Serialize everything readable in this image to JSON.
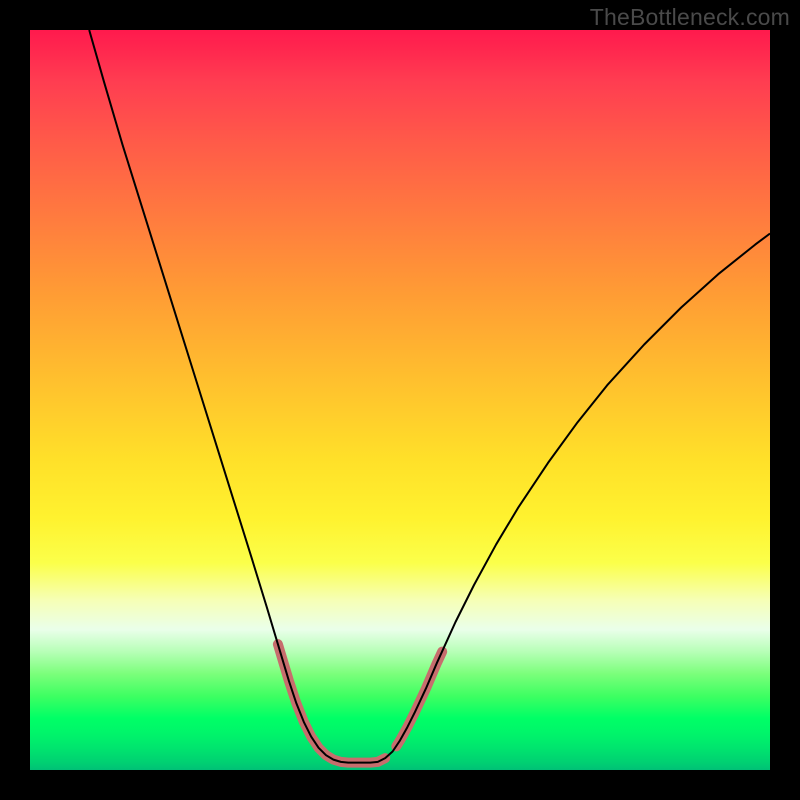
{
  "watermark": "TheBottleneck.com",
  "chart_data": {
    "type": "line",
    "title": "",
    "xlabel": "",
    "ylabel": "",
    "xlim": [
      0,
      100
    ],
    "ylim": [
      0,
      100
    ],
    "legend": false,
    "grid": false,
    "series": [
      {
        "name": "bottleneck-curve",
        "stroke": "#000000",
        "stroke_width": 2,
        "points": [
          {
            "x": 8.0,
            "y": 100.0
          },
          {
            "x": 10.0,
            "y": 93.0
          },
          {
            "x": 12.5,
            "y": 84.5
          },
          {
            "x": 15.0,
            "y": 76.5
          },
          {
            "x": 17.5,
            "y": 68.5
          },
          {
            "x": 20.0,
            "y": 60.5
          },
          {
            "x": 22.5,
            "y": 52.5
          },
          {
            "x": 25.0,
            "y": 44.5
          },
          {
            "x": 27.5,
            "y": 36.5
          },
          {
            "x": 30.0,
            "y": 28.5
          },
          {
            "x": 32.0,
            "y": 22.0
          },
          {
            "x": 33.5,
            "y": 17.0
          },
          {
            "x": 35.0,
            "y": 12.0
          },
          {
            "x": 36.0,
            "y": 9.0
          },
          {
            "x": 37.0,
            "y": 6.5
          },
          {
            "x": 38.0,
            "y": 4.5
          },
          {
            "x": 39.0,
            "y": 3.0
          },
          {
            "x": 40.0,
            "y": 2.0
          },
          {
            "x": 41.0,
            "y": 1.4
          },
          {
            "x": 42.0,
            "y": 1.1
          },
          {
            "x": 43.0,
            "y": 1.0
          },
          {
            "x": 44.0,
            "y": 1.0
          },
          {
            "x": 45.0,
            "y": 1.0
          },
          {
            "x": 46.0,
            "y": 1.0
          },
          {
            "x": 47.0,
            "y": 1.1
          },
          {
            "x": 48.0,
            "y": 1.6
          },
          {
            "x": 49.0,
            "y": 2.5
          },
          {
            "x": 50.0,
            "y": 4.0
          },
          {
            "x": 51.0,
            "y": 5.8
          },
          {
            "x": 52.0,
            "y": 7.8
          },
          {
            "x": 53.5,
            "y": 11.0
          },
          {
            "x": 55.0,
            "y": 14.5
          },
          {
            "x": 57.5,
            "y": 20.0
          },
          {
            "x": 60.0,
            "y": 25.0
          },
          {
            "x": 63.0,
            "y": 30.5
          },
          {
            "x": 66.0,
            "y": 35.5
          },
          {
            "x": 70.0,
            "y": 41.5
          },
          {
            "x": 74.0,
            "y": 47.0
          },
          {
            "x": 78.0,
            "y": 52.0
          },
          {
            "x": 83.0,
            "y": 57.5
          },
          {
            "x": 88.0,
            "y": 62.5
          },
          {
            "x": 93.0,
            "y": 67.0
          },
          {
            "x": 98.0,
            "y": 71.0
          },
          {
            "x": 100.0,
            "y": 72.5
          }
        ]
      },
      {
        "name": "highlight-segments",
        "stroke": "#c76d6d",
        "stroke_width": 10,
        "linecap": "round",
        "segments": [
          [
            {
              "x": 33.5,
              "y": 17.0
            },
            {
              "x": 35.0,
              "y": 12.0
            },
            {
              "x": 36.0,
              "y": 9.0
            },
            {
              "x": 37.0,
              "y": 6.5
            },
            {
              "x": 38.0,
              "y": 4.5
            },
            {
              "x": 39.0,
              "y": 3.0
            },
            {
              "x": 40.0,
              "y": 2.0
            },
            {
              "x": 41.0,
              "y": 1.4
            },
            {
              "x": 42.0,
              "y": 1.1
            },
            {
              "x": 43.0,
              "y": 1.0
            },
            {
              "x": 44.0,
              "y": 1.0
            },
            {
              "x": 45.0,
              "y": 1.0
            },
            {
              "x": 46.0,
              "y": 1.0
            },
            {
              "x": 47.0,
              "y": 1.1
            },
            {
              "x": 48.0,
              "y": 1.6
            }
          ],
          [
            {
              "x": 49.5,
              "y": 3.2
            },
            {
              "x": 50.0,
              "y": 4.0
            },
            {
              "x": 51.0,
              "y": 5.8
            },
            {
              "x": 52.0,
              "y": 7.8
            },
            {
              "x": 53.5,
              "y": 11.0
            },
            {
              "x": 55.0,
              "y": 14.5
            },
            {
              "x": 55.7,
              "y": 16.0
            }
          ]
        ]
      }
    ]
  }
}
